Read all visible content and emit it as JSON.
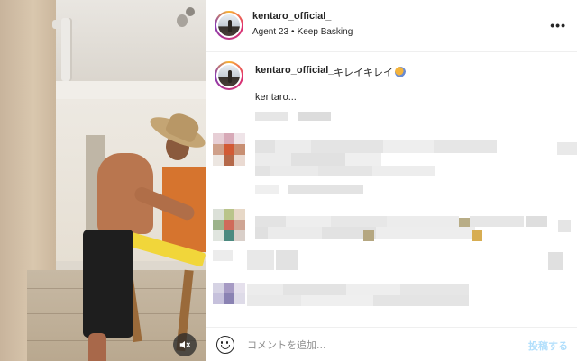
{
  "post": {
    "username": "kentaro_official_",
    "subtitle_left": "Agent 23",
    "subtitle_sep": "•",
    "subtitle_right": "Keep Basking",
    "more_label": "•••",
    "caption_user": "kentaro_official_",
    "caption_text": "キレイキレイ",
    "caption_line2": "kentaro..."
  },
  "composer": {
    "placeholder": "コメントを追加...",
    "post_label": "投稿する"
  },
  "icons": {
    "mute": "speaker-muted-icon",
    "emoji": "smiley-icon",
    "more": "ellipsis-icon"
  },
  "colors": {
    "accent_disabled": "#b2dffc",
    "text": "#262626",
    "muted": "#8e8e8e"
  }
}
